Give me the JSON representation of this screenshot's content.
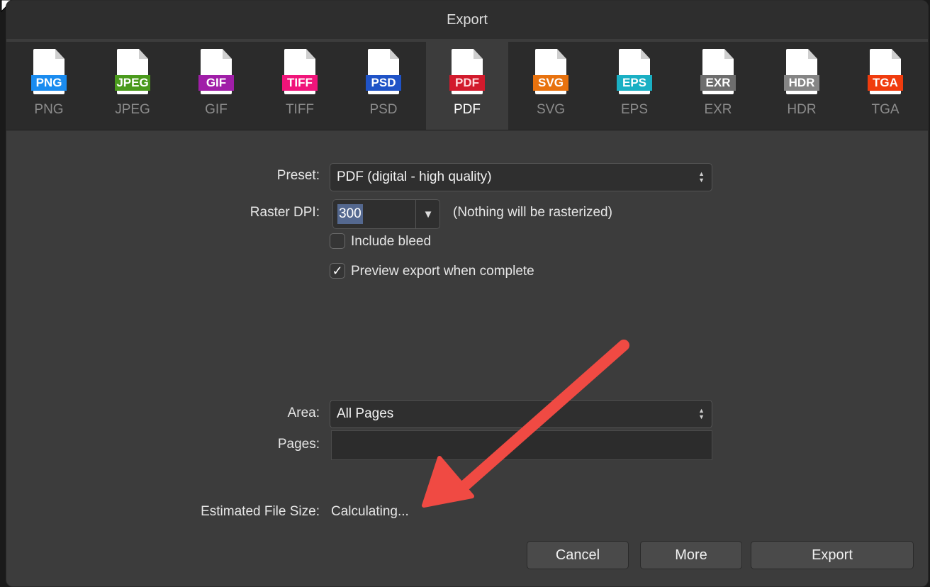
{
  "window": {
    "title": "Export"
  },
  "formats": [
    {
      "name": "PNG",
      "badge": "PNG",
      "color": "#1a8cf0",
      "selected": false
    },
    {
      "name": "JPEG",
      "badge": "JPEG",
      "color": "#4a9a1c",
      "selected": false
    },
    {
      "name": "GIF",
      "badge": "GIF",
      "color": "#a01ea8",
      "selected": false
    },
    {
      "name": "TIFF",
      "badge": "TIFF",
      "color": "#f0147a",
      "selected": false
    },
    {
      "name": "PSD",
      "badge": "PSD",
      "color": "#1f53c7",
      "selected": false
    },
    {
      "name": "PDF",
      "badge": "PDF",
      "color": "#d21a2c",
      "selected": true
    },
    {
      "name": "SVG",
      "badge": "SVG",
      "color": "#e8720e",
      "selected": false
    },
    {
      "name": "EPS",
      "badge": "EPS",
      "color": "#1ab0c4",
      "selected": false
    },
    {
      "name": "EXR",
      "badge": "EXR",
      "color": "#6e6e6e",
      "selected": false
    },
    {
      "name": "HDR",
      "badge": "HDR",
      "color": "#858585",
      "selected": false
    },
    {
      "name": "TGA",
      "badge": "TGA",
      "color": "#f03c0e",
      "selected": false
    }
  ],
  "settings": {
    "preset_label": "Preset:",
    "preset_value": "PDF (digital - high quality)",
    "raster_dpi_label": "Raster DPI:",
    "raster_dpi_value": "300",
    "raster_note": "(Nothing will be rasterized)",
    "include_bleed_label": "Include bleed",
    "include_bleed_checked": false,
    "preview_label": "Preview export when complete",
    "preview_checked": true,
    "area_label": "Area:",
    "area_value": "All Pages",
    "pages_label": "Pages:",
    "pages_value": "",
    "file_size_label": "Estimated File Size:",
    "file_size_value": "Calculating..."
  },
  "buttons": {
    "cancel": "Cancel",
    "more": "More",
    "export": "Export"
  },
  "icons": {
    "checkmark": "✓",
    "dropdown_arrow": "▼",
    "stepper": "▲▼"
  },
  "annotation": {
    "type": "arrow",
    "color": "#f04a43",
    "points_to": "file-size-value"
  }
}
